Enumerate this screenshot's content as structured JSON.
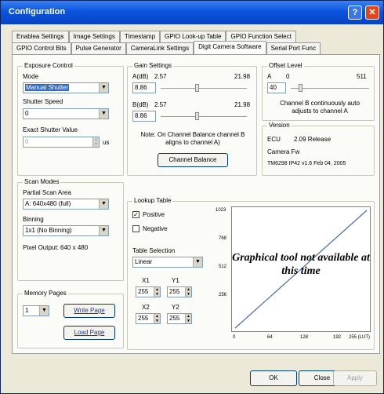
{
  "window": {
    "title": "Configuration",
    "help_glyph": "?",
    "close_glyph": "✕"
  },
  "tabs_row1": [
    "Enablea Settings",
    "Image Settings",
    "Timestamp",
    "GPIO Look-up Table",
    "GPIO Function Select"
  ],
  "tabs_row2": [
    "GPIO Control Bits",
    "Pulse Generator",
    "CameraLink Settings",
    "Digit Camera Software",
    "Serial Port Func"
  ],
  "active_tab": "Digit Camera Software",
  "exposure": {
    "legend": "Exposure Control",
    "mode_label": "Mode",
    "mode_value": "Manual Shutter",
    "shutter_label": "Shutter Speed",
    "shutter_value": "0",
    "exact_label": "Exact Shutter Value",
    "exact_value": "0",
    "exact_unit": "us"
  },
  "gain": {
    "legend": "Gain Settings",
    "a_label": "A(dB)",
    "a_min": "2.57",
    "a_max": "21.98",
    "a_value": "8.86",
    "b_label": "B(dB)",
    "b_min": "2.57",
    "b_max": "21.98",
    "b_value": "8.86",
    "note": "Note: On Channel Balance channel B aligns to channel A)",
    "balance_button": "Channel Balance"
  },
  "offset": {
    "legend": "Offset Level",
    "a_label": "A",
    "a_min": "0",
    "a_max": "511",
    "a_value": "40",
    "note": "Channel B continuously auto adjusts to channel A"
  },
  "version": {
    "legend": "Version",
    "ecu_label": "ECU",
    "ecu_value": "2.09 Release",
    "fw_label": "Camera Fw",
    "fw_value": "TM6298 IP42 v1.6  Feb 04, 2005"
  },
  "scan": {
    "legend": "Scan Modes",
    "partial_label": "Partial Scan Area",
    "partial_value": "A: 640x480 (full)",
    "binning_label": "Binning",
    "binning_value": "1x1 (No Binning)",
    "pixel_output": "Pixel Output: 640 x 480"
  },
  "lut": {
    "legend": "Lookup Table",
    "positive_label": "Positive",
    "negative_label": "Negative",
    "table_sel_label": "Table Selection",
    "table_sel_value": "Linear",
    "x1_label": "X1",
    "x1_value": "255",
    "y1_label": "Y1",
    "y1_value": "255",
    "x2_label": "X2",
    "x2_value": "255",
    "y2_label": "Y2",
    "y2_value": "255",
    "graph_msg": "Graphical tool not available at this time",
    "y_ticks": [
      "1023",
      "768",
      "512",
      "256"
    ],
    "x_ticks": [
      "0",
      "64",
      "128",
      "192",
      "255 (LUT)"
    ]
  },
  "memory": {
    "legend": "Memory Pages",
    "page_value": "1",
    "write_button": "Write Page",
    "load_button": "Load Page"
  },
  "footer": {
    "ok": "OK",
    "close": "Close",
    "apply": "Apply"
  }
}
